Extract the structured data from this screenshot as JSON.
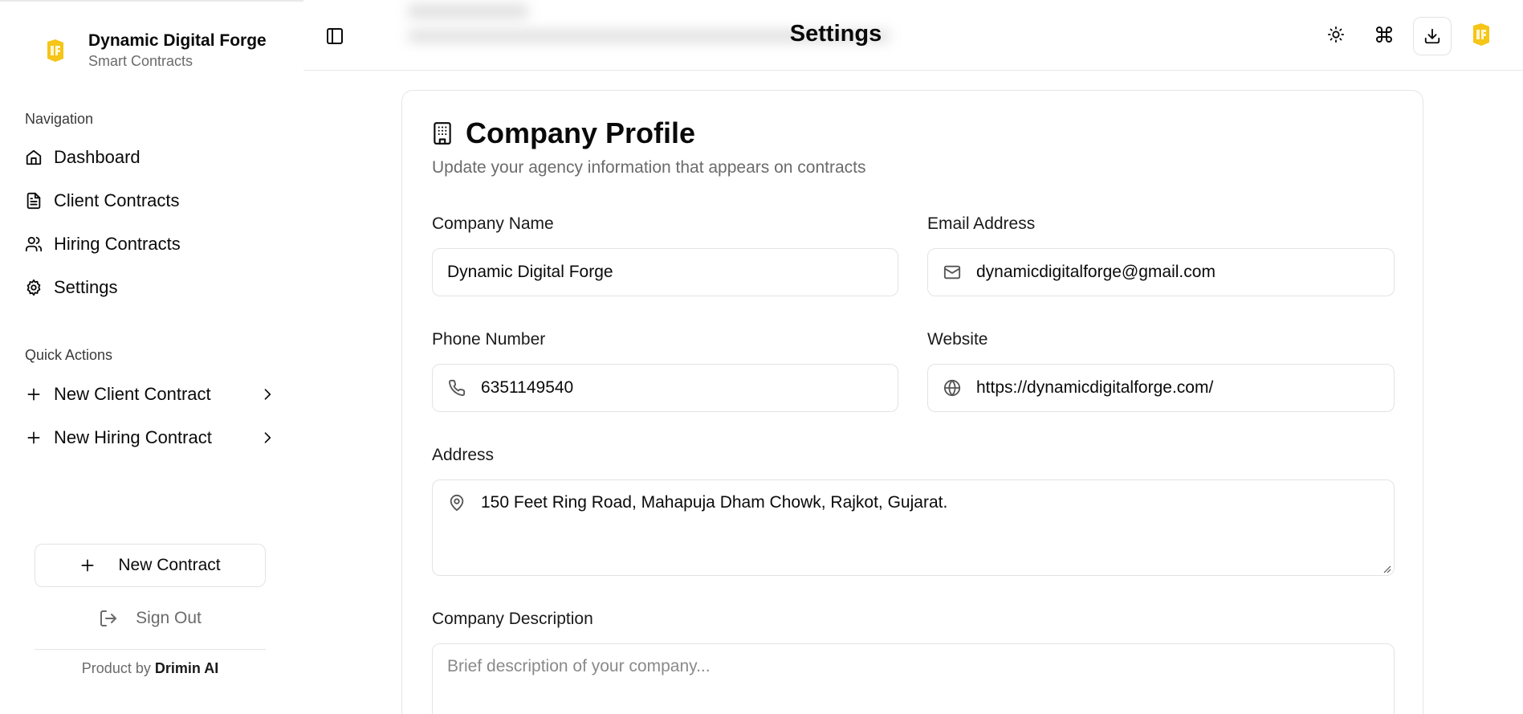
{
  "brand": {
    "name": "Dynamic Digital Forge",
    "subtitle": "Smart Contracts",
    "accent": "#f5c518"
  },
  "sidebar": {
    "navigation_label": "Navigation",
    "nav_items": [
      {
        "label": "Dashboard",
        "icon": "home-icon"
      },
      {
        "label": "Client Contracts",
        "icon": "file-text-icon"
      },
      {
        "label": "Hiring Contracts",
        "icon": "users-icon"
      },
      {
        "label": "Settings",
        "icon": "gear-icon",
        "active": true
      }
    ],
    "quick_actions_label": "Quick Actions",
    "quick_actions": [
      {
        "label": "New Client Contract",
        "icon": "plus-icon"
      },
      {
        "label": "New Hiring Contract",
        "icon": "plus-icon"
      }
    ],
    "new_contract_label": "New Contract",
    "sign_out_label": "Sign Out",
    "product_by_prefix": "Product by",
    "product_by_name": "Drimin AI"
  },
  "header": {
    "title": "Settings",
    "icons": [
      "sidebar-toggle-icon",
      "sun-icon",
      "command-icon",
      "download-icon",
      "logo-icon"
    ]
  },
  "profile": {
    "title": "Company Profile",
    "description": "Update your agency information that appears on contracts",
    "company_name_label": "Company Name",
    "company_name_value": "Dynamic Digital Forge",
    "email_label": "Email Address",
    "email_value": "dynamicdigitalforge@gmail.com",
    "phone_label": "Phone Number",
    "phone_value": "6351149540",
    "website_label": "Website",
    "website_value": "https://dynamicdigitalforge.com/",
    "address_label": "Address",
    "address_value": "150 Feet Ring Road, Mahapuja Dham Chowk, Rajkot, Gujarat.",
    "description_label": "Company Description",
    "description_placeholder": "Brief description of your company..."
  }
}
